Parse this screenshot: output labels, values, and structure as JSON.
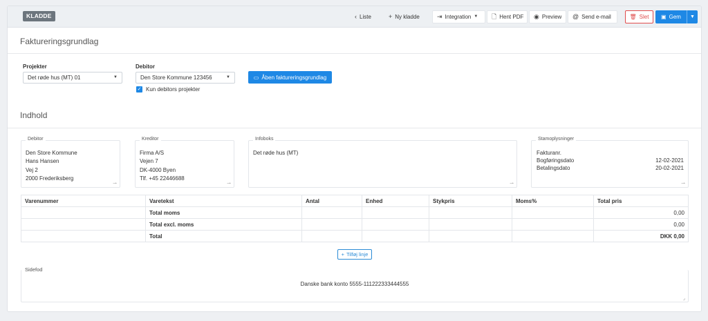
{
  "toolbar": {
    "badge": "KLADDE",
    "liste": "Liste",
    "ny_kladde": "Ny kladde",
    "integration": "Integration",
    "hent_pdf": "Hent PDF",
    "preview": "Preview",
    "send_email": "Send e-mail",
    "slet": "Slet",
    "gem": "Gem"
  },
  "faktureringsgrundlag": {
    "title": "Faktureringsgrundlag",
    "projekter_label": "Projekter",
    "projekter_value": "Det røde hus (MT) 01",
    "debitor_label": "Debitor",
    "debitor_value": "Den Store Kommune 123456",
    "kun_debitors_projekter": "Kun debitors projekter",
    "aaben_button": "Åben faktureringsgrundlag"
  },
  "indhold": {
    "title": "Indhold",
    "debitor": {
      "legend": "Debitor",
      "lines": [
        "Den Store Kommune",
        "Hans Hansen",
        "Vej 2",
        "2000  Frederiksberg"
      ]
    },
    "kreditor": {
      "legend": "Kreditor",
      "lines": [
        "Firma A/S",
        "Vejen 7",
        "DK-4000  Byen",
        "Tlf. +45 22446688"
      ]
    },
    "infoboks": {
      "legend": "Infoboks",
      "text": "Det røde hus (MT)"
    },
    "stamoplysninger": {
      "legend": "Stamoplysninger",
      "fakturanr_label": "Fakturanr.",
      "bogforingsdato_label": "Bogføringsdato",
      "bogforingsdato_value": "12-02-2021",
      "betalingsdato_label": "Betalingsdato",
      "betalingsdato_value": "20-02-2021"
    }
  },
  "table": {
    "headers": [
      "Varenummer",
      "Varetekst",
      "Antal",
      "Enhed",
      "Stykpris",
      "Moms%",
      "Total pris"
    ],
    "rows": [
      {
        "label": "Total moms",
        "value": "0,00"
      },
      {
        "label": "Total excl. moms",
        "value": "0,00"
      },
      {
        "label": "Total",
        "value": "DKK 0,00"
      }
    ]
  },
  "tilfoej_linje": "Tilføj linje",
  "sidefod": {
    "legend": "Sidefod",
    "text": "Danske bank konto 5555-111222333444555"
  },
  "colors": {
    "primary": "#1e88e5",
    "danger": "#e04b4b",
    "badge": "#6c757d"
  }
}
